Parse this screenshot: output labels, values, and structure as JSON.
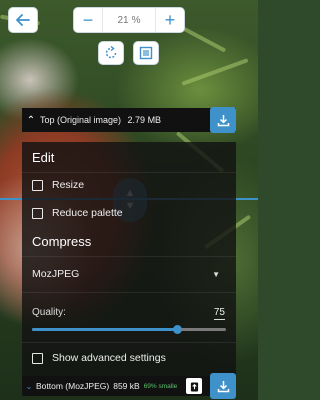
{
  "zoom": {
    "value": "21",
    "unit": "%",
    "minus_label": "−",
    "plus_label": "+"
  },
  "toolbar": {
    "back_icon": "arrow-left-icon",
    "rotate_icon": "rotate-icon",
    "background_toggle_icon": "background-toggle-icon"
  },
  "top_output": {
    "label": "Top (Original image)",
    "size": "2.79 MB",
    "chevron": "⌃"
  },
  "edit": {
    "title": "Edit",
    "resize_label": "Resize",
    "resize_checked": false,
    "reduce_palette_label": "Reduce palette",
    "reduce_palette_checked": false
  },
  "compress": {
    "title": "Compress",
    "codec": "MozJPEG",
    "quality_label": "Quality:",
    "quality_value": "75",
    "quality": 75,
    "quality_max": 100,
    "advanced_label": "Show advanced settings",
    "advanced_checked": false
  },
  "bottom_output": {
    "label": "Bottom (MozJPEG)",
    "size": "859 kB",
    "savings": "69% smalle",
    "chevron": "⌄"
  },
  "colors": {
    "accent": "#3f91c9",
    "savings": "#5cc36c",
    "panel_bg": "#121212"
  }
}
